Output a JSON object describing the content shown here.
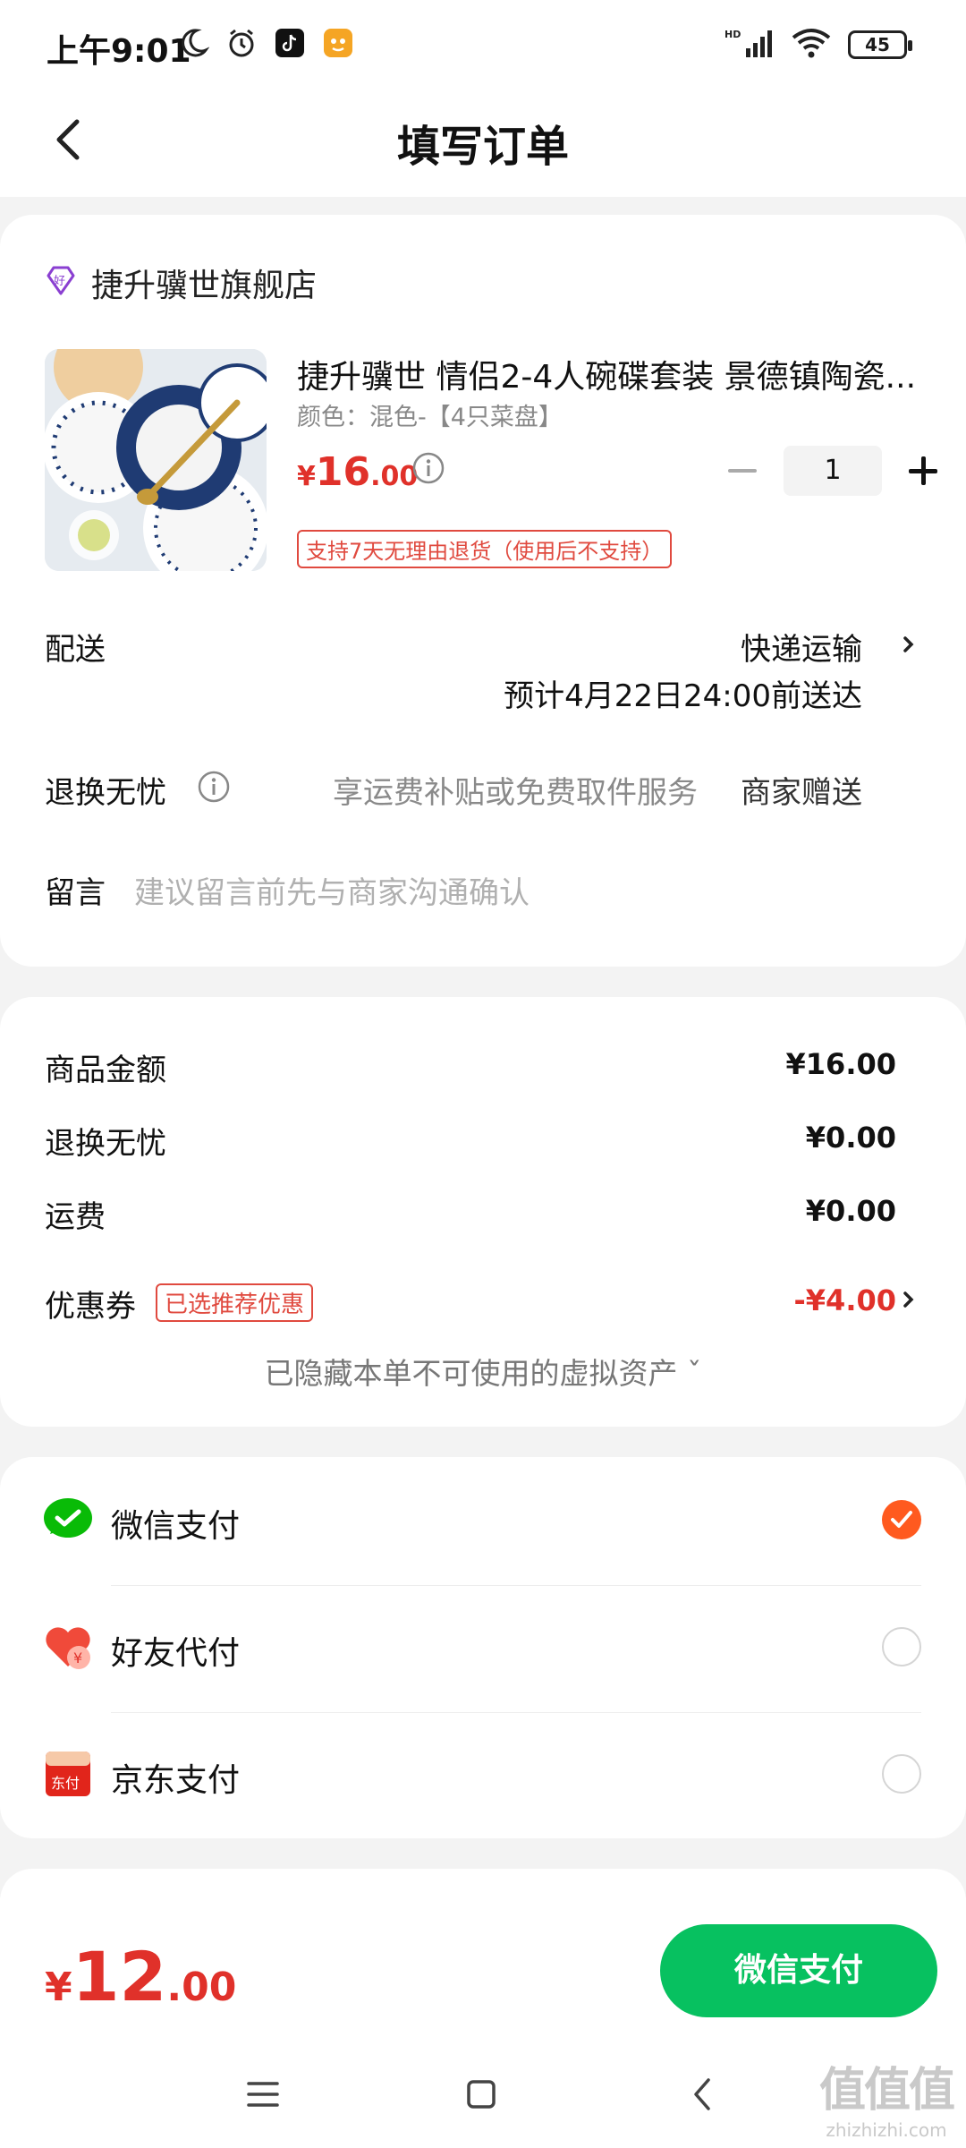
{
  "status_bar": {
    "time": "上午9:01",
    "battery": "45"
  },
  "header": {
    "title": "填写订单"
  },
  "store": {
    "name": "捷升骥世旗舰店",
    "product": {
      "title": "捷升骥世 情侣2-4人碗碟套装 景德镇陶瓷...",
      "spec": "颜色：混色-【4只菜盘】",
      "price_symbol": "¥",
      "price_int": "16",
      "price_dec": ".00",
      "quantity": "1",
      "return_tag": "支持7天无理由退货（使用后不支持）"
    },
    "delivery": {
      "label": "配送",
      "mode": "快递运输",
      "estimate": "预计4月22日24:00前送达"
    },
    "exchange": {
      "label": "退换无忧",
      "desc": "享运费补贴或免费取件服务",
      "gift": "商家赠送"
    },
    "message": {
      "label": "留言",
      "placeholder": "建议留言前先与商家沟通确认"
    }
  },
  "amounts": {
    "items": [
      {
        "label": "商品金额",
        "value": "¥16.00"
      },
      {
        "label": "退换无忧",
        "value": "¥0.00"
      },
      {
        "label": "运费",
        "value": "¥0.00"
      }
    ],
    "coupon": {
      "label": "优惠券",
      "tag": "已选推荐优惠",
      "value": "-¥4.00"
    },
    "hidden_assets": "已隐藏本单不可使用的虚拟资产 ˇ"
  },
  "payment": {
    "methods": [
      {
        "label": "微信支付",
        "icon": "wechat-pay-icon",
        "selected": true
      },
      {
        "label": "好友代付",
        "icon": "friend-pay-icon",
        "selected": false
      },
      {
        "label": "京东支付",
        "icon": "jd-pay-icon",
        "selected": false
      }
    ],
    "jd_icon_text": "东付"
  },
  "bottom": {
    "total_symbol": "¥",
    "total_int": "12",
    "total_dec": ".00",
    "pay_button": "微信支付"
  },
  "watermark": {
    "top": "值值值",
    "bottom": "zhizhizhi.com"
  },
  "colors": {
    "accent_red": "#e0312a",
    "wechat_green": "#07c160",
    "check_orange": "#ff5a1f"
  }
}
